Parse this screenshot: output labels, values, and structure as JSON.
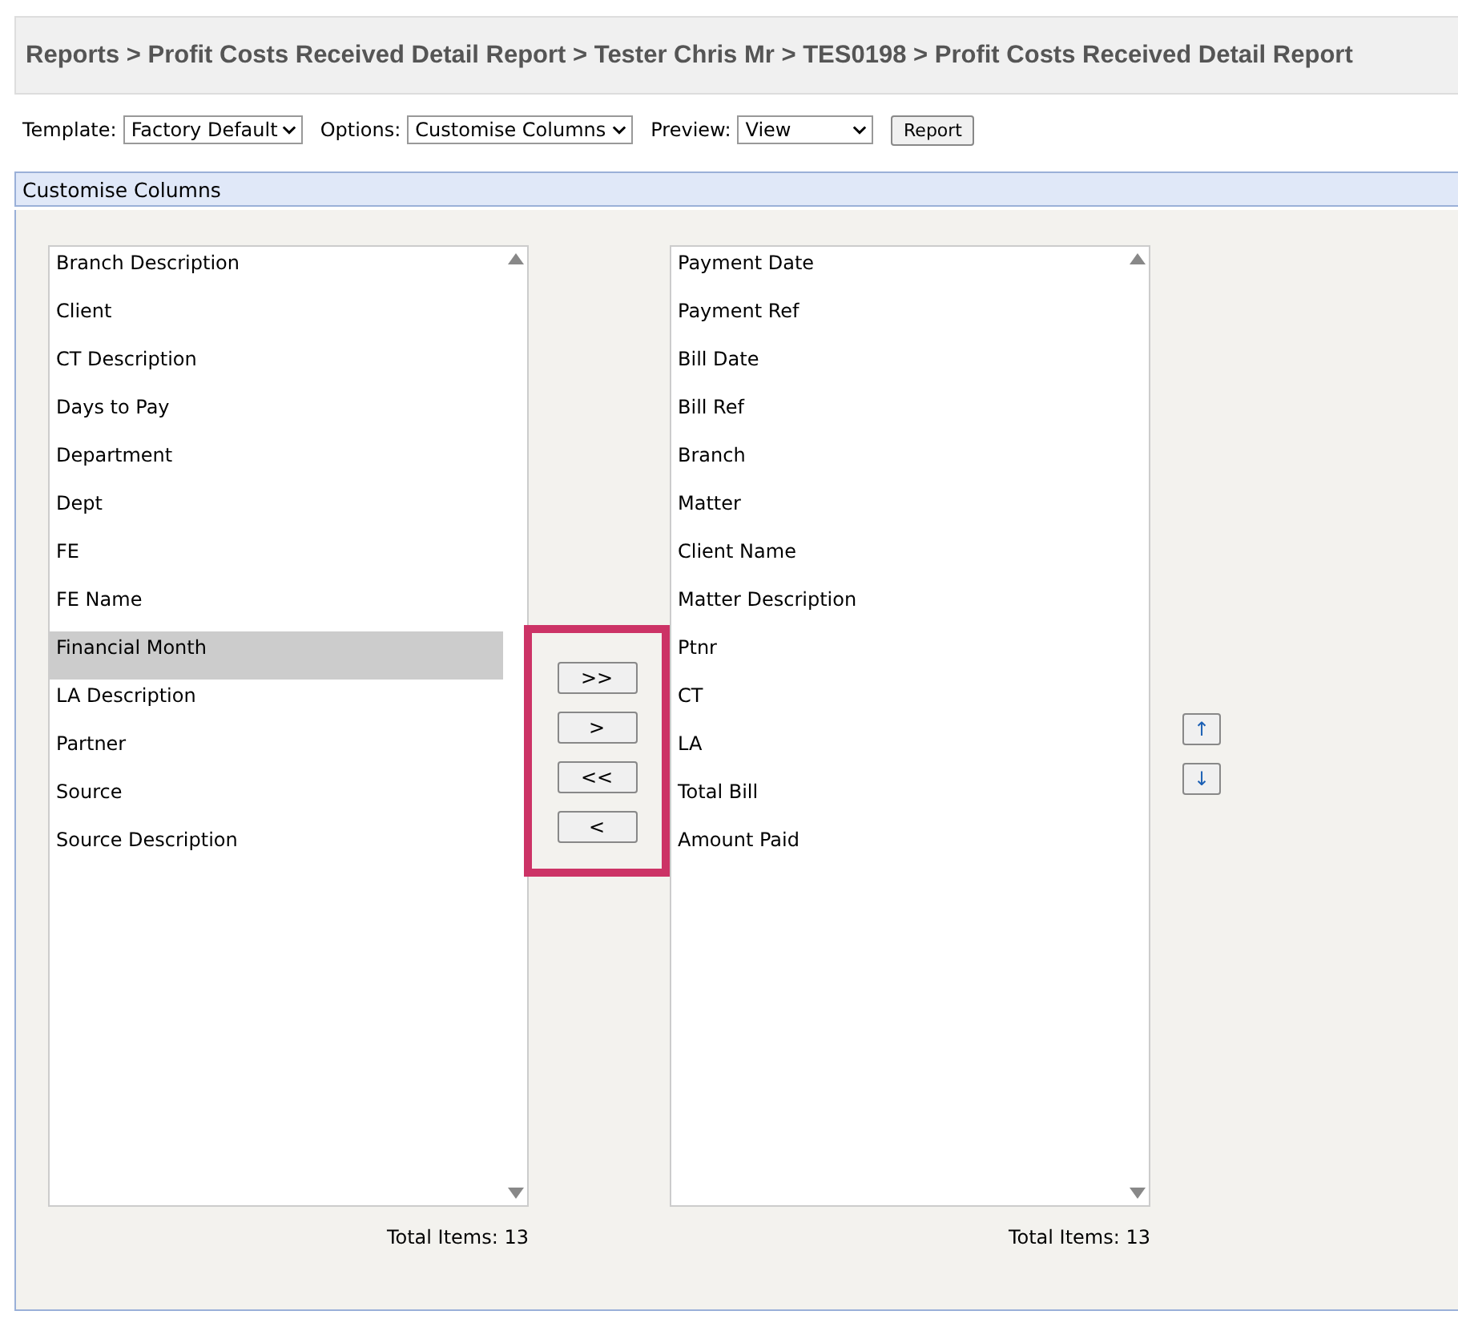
{
  "breadcrumb": "Reports > Profit Costs Received Detail Report > Tester Chris Mr > TES0198 > Profit Costs Received Detail Report",
  "toolbar": {
    "fields": [
      {
        "label": "Template:",
        "value": "Factory Default"
      },
      {
        "label": "Options:",
        "value": "Customise Columns"
      },
      {
        "label": "Preview:",
        "value": "View"
      }
    ],
    "button": "Report"
  },
  "panel": {
    "title": "Customise Columns",
    "available": {
      "items": [
        {
          "label": "Branch Description",
          "selected": false
        },
        {
          "label": "Client",
          "selected": false
        },
        {
          "label": "CT Description",
          "selected": false
        },
        {
          "label": "Days to Pay",
          "selected": false
        },
        {
          "label": "Department",
          "selected": false
        },
        {
          "label": "Dept",
          "selected": false
        },
        {
          "label": "FE",
          "selected": false
        },
        {
          "label": "FE Name",
          "selected": false
        },
        {
          "label": "Financial Month",
          "selected": true
        },
        {
          "label": "LA Description",
          "selected": false
        },
        {
          "label": "Partner",
          "selected": false
        },
        {
          "label": "Source",
          "selected": false
        },
        {
          "label": "Source Description",
          "selected": false
        }
      ],
      "total": "Total Items: 13"
    },
    "transfer_buttons": [
      ">>",
      ">",
      "<<",
      "<"
    ],
    "chosen": {
      "items": [
        {
          "label": "Payment Date",
          "selected": false
        },
        {
          "label": "Payment Ref",
          "selected": false
        },
        {
          "label": "Bill Date",
          "selected": false
        },
        {
          "label": "Bill Ref",
          "selected": false
        },
        {
          "label": "Branch",
          "selected": false
        },
        {
          "label": "Matter",
          "selected": false
        },
        {
          "label": "Client Name",
          "selected": false
        },
        {
          "label": "Matter Description",
          "selected": false
        },
        {
          "label": "Ptnr",
          "selected": false
        },
        {
          "label": "CT",
          "selected": false
        },
        {
          "label": "LA",
          "selected": false
        },
        {
          "label": "Total Bill",
          "selected": false
        },
        {
          "label": "Amount Paid",
          "selected": false
        }
      ],
      "total": "Total Items: 13"
    },
    "order_buttons": [
      "↑",
      "↓"
    ]
  }
}
